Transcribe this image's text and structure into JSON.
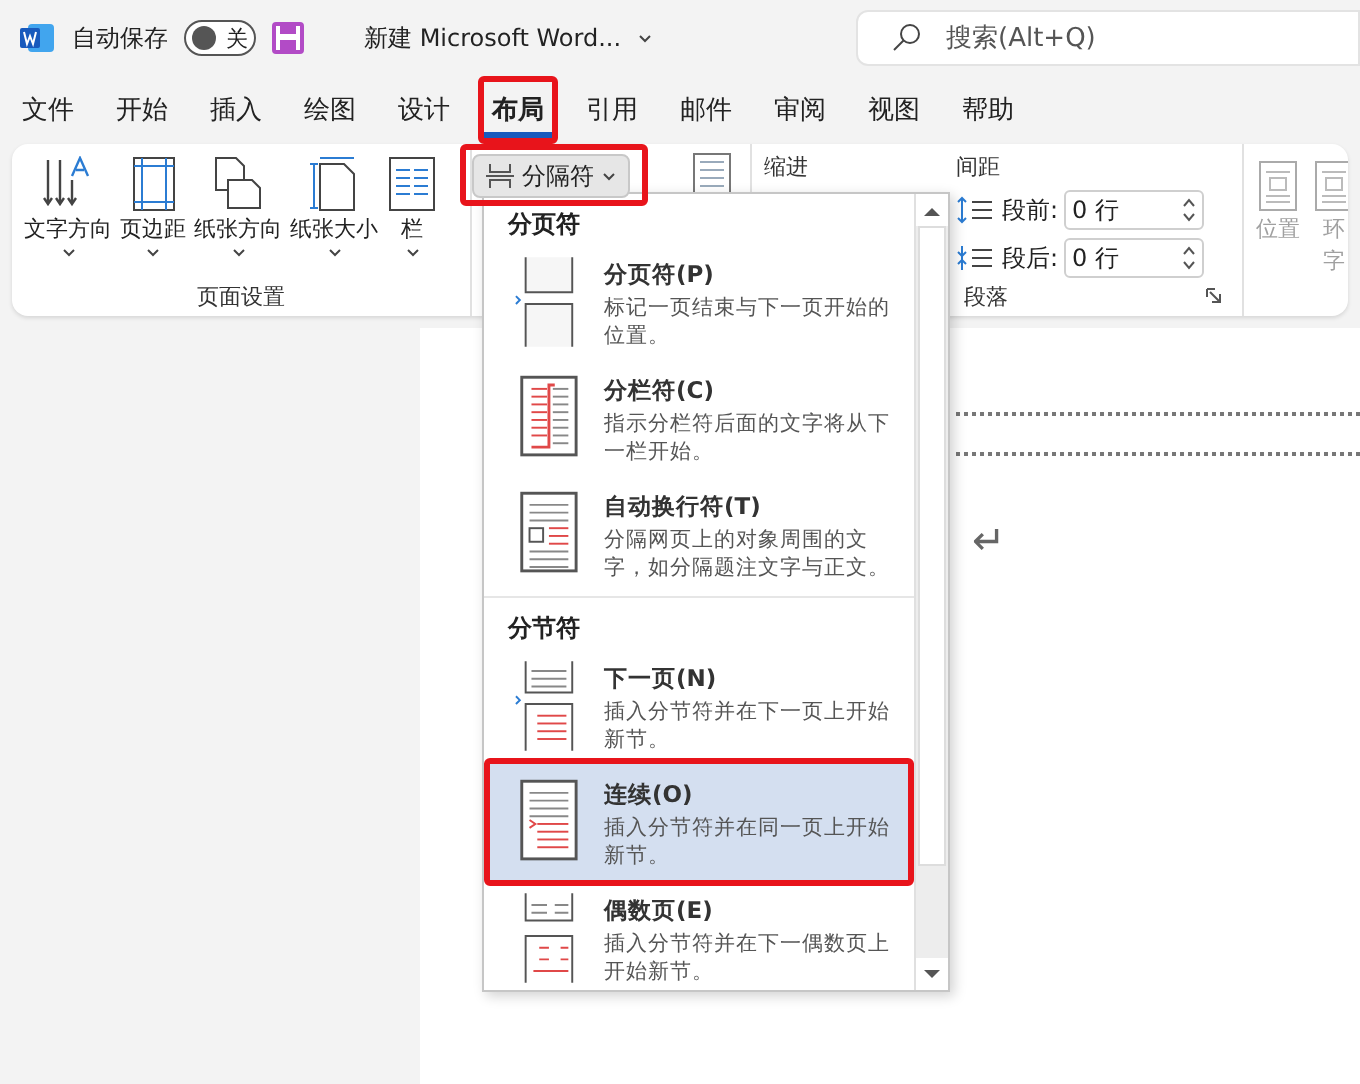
{
  "title_bar": {
    "autosave": {
      "label": "自动保存",
      "on": false,
      "state_label": "关"
    },
    "document_title": "新建 Microsoft Word...",
    "search": {
      "placeholder": "搜索(Alt+Q)"
    }
  },
  "tabs": [
    {
      "label": "文件",
      "selected": false,
      "highlighted": false
    },
    {
      "label": "开始",
      "selected": false,
      "highlighted": false
    },
    {
      "label": "插入",
      "selected": false,
      "highlighted": false
    },
    {
      "label": "绘图",
      "selected": false,
      "highlighted": false
    },
    {
      "label": "设计",
      "selected": false,
      "highlighted": false
    },
    {
      "label": "布局",
      "selected": true,
      "highlighted": true
    },
    {
      "label": "引用",
      "selected": false,
      "highlighted": false
    },
    {
      "label": "邮件",
      "selected": false,
      "highlighted": false
    },
    {
      "label": "审阅",
      "selected": false,
      "highlighted": false
    },
    {
      "label": "视图",
      "selected": false,
      "highlighted": false
    },
    {
      "label": "帮助",
      "selected": false,
      "highlighted": false
    }
  ],
  "ribbon": {
    "page_setup": {
      "label": "页面设置",
      "buttons": [
        {
          "kind": "text-direction",
          "label": "文字方向"
        },
        {
          "kind": "margins",
          "label": "页边距"
        },
        {
          "kind": "orientation",
          "label": "纸张方向"
        },
        {
          "kind": "size",
          "label": "纸张大小"
        },
        {
          "kind": "columns",
          "label": "栏"
        }
      ]
    },
    "breaks_button": {
      "label": "分隔符",
      "highlighted": true,
      "expanded": true
    },
    "paragraph": {
      "label": "段落",
      "indent_label": "缩进",
      "spacing_label": "间距",
      "spacing": [
        {
          "kind": "before",
          "label": "段前:",
          "value": "0 行"
        },
        {
          "kind": "after",
          "label": "段后:",
          "value": "0 行"
        }
      ]
    },
    "arrange": [
      {
        "lines": [
          "位置"
        ],
        "disabled": true
      },
      {
        "lines": [
          "环",
          "字"
        ],
        "disabled": true
      }
    ]
  },
  "breaks_menu": {
    "sections": [
      {
        "heading": "分页符",
        "items": [
          {
            "kind": "page",
            "title": "分页符(P)",
            "description": "标记一页结束与下一页开始的位置。",
            "selected": false,
            "highlighted": false
          },
          {
            "kind": "column",
            "title": "分栏符(C)",
            "description": "指示分栏符后面的文字将从下一栏开始。",
            "selected": false,
            "highlighted": false
          },
          {
            "kind": "wrap",
            "title": "自动换行符(T)",
            "description": "分隔网页上的对象周围的文字，如分隔题注文字与正文。",
            "selected": false,
            "highlighted": false
          }
        ]
      },
      {
        "heading": "分节符",
        "items": [
          {
            "kind": "next",
            "title": "下一页(N)",
            "description": "插入分节符并在下一页上开始新节。",
            "selected": false,
            "highlighted": false
          },
          {
            "kind": "continuous",
            "title": "连续(O)",
            "description": "插入分节符并在同一页上开始新节。",
            "selected": true,
            "highlighted": true
          },
          {
            "kind": "even",
            "title": "偶数页(E)",
            "description": "插入分节符并在下一偶数页上开始新节。",
            "selected": false,
            "highlighted": false
          }
        ]
      }
    ]
  },
  "document": {
    "paragraph_mark": "↵"
  }
}
